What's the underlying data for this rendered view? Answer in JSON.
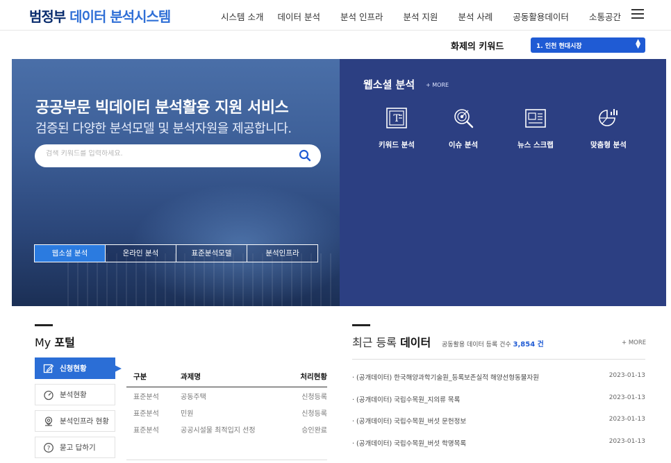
{
  "header": {
    "logo_part1": "범정부",
    "logo_part2": "데이터 분석시스템",
    "nav": [
      "시스템 소개",
      "데이터 분석",
      "분석 인프라",
      "분석 지원",
      "분석 사례",
      "공동활용데이터",
      "소통공간"
    ]
  },
  "keyword": {
    "label": "화제의 키워드",
    "selected": "1. 인천 현대시장"
  },
  "hero": {
    "title": "공공부문 빅데이터 분석활용 지원 서비스",
    "subtitle": "검증된 다양한 분석모델 및 분석자원을 제공합니다.",
    "search_placeholder": "검색 키워드를 입력하세요.",
    "tabs": [
      "웹소셜 분석",
      "온라인 분석",
      "표준분석모델",
      "분석인프라"
    ]
  },
  "websocial": {
    "title": "웹소셜 분석",
    "more": "+ MORE",
    "items": [
      "키워드 분석",
      "이슈 분석",
      "뉴스 스크랩",
      "맞춤형 분석"
    ]
  },
  "portal": {
    "title_light": "My",
    "title_bold": "포털",
    "menu": [
      "신청현황",
      "분석현황",
      "분석인프라 현황",
      "묻고 답하기"
    ],
    "columns": [
      "구분",
      "과제명",
      "처리현황"
    ],
    "rows": [
      [
        "표준분석",
        "공동주택",
        "신청등록"
      ],
      [
        "표준분석",
        "민원",
        "신청등록"
      ],
      [
        "표준분석",
        "공공시설물 최적입지 선정",
        "승인완료"
      ]
    ]
  },
  "recent": {
    "title_light": "최근 등록",
    "title_bold": "데이터",
    "count_label": "공동활용 데이터 등록 건수",
    "count_value": "3,854 건",
    "more": "+ MORE",
    "items": [
      {
        "title": "· (공개데이터) 한국해양과학기술원_등록보존실적 해양선형동물자원",
        "date": "2023-01-13"
      },
      {
        "title": "· (공개데이터) 국립수목원_지의류 목록",
        "date": "2023-01-13"
      },
      {
        "title": "· (공개데이터) 국립수목원_버섯 문헌정보",
        "date": "2023-01-13"
      },
      {
        "title": "· (공개데이터) 국립수목원_버섯 학명목록",
        "date": "2023-01-13"
      }
    ]
  },
  "colors": {
    "brand_dark": "#0a2d6e",
    "brand_blue": "#2f6fd6",
    "accent": "#1f5bd4",
    "hero_right_bg": "#2c3f82"
  }
}
